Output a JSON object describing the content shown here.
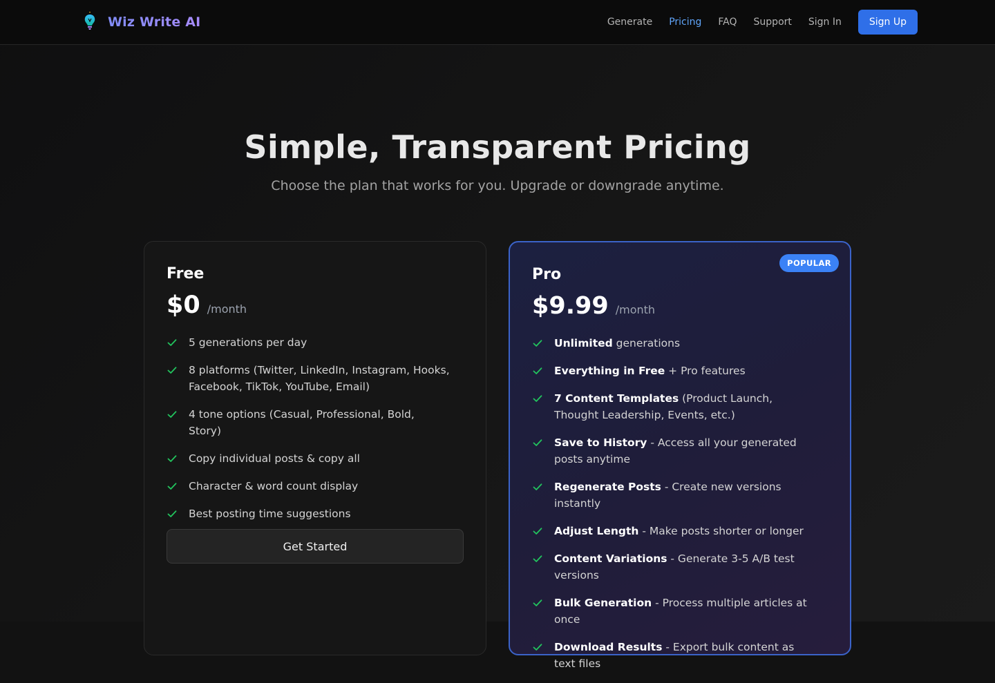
{
  "brand": {
    "name": "Wiz Write AI",
    "icon": "wizard-bulb-icon"
  },
  "nav": {
    "items": [
      {
        "label": "Generate",
        "active": false
      },
      {
        "label": "Pricing",
        "active": true
      },
      {
        "label": "FAQ",
        "active": false
      },
      {
        "label": "Support",
        "active": false
      },
      {
        "label": "Sign In",
        "active": false
      }
    ],
    "signup_label": "Sign Up"
  },
  "hero": {
    "title": "Simple, Transparent Pricing",
    "subtitle": "Choose the plan that works for you. Upgrade or downgrade anytime."
  },
  "plans": [
    {
      "name": "Free",
      "price": "$0",
      "period": "/month",
      "features": [
        {
          "bold": "",
          "text": "5 generations per day"
        },
        {
          "bold": "",
          "text": "8 platforms (Twitter, LinkedIn, Instagram, Hooks, Facebook, TikTok, YouTube, Email)"
        },
        {
          "bold": "",
          "text": "4 tone options (Casual, Professional, Bold, Story)"
        },
        {
          "bold": "",
          "text": "Copy individual posts & copy all"
        },
        {
          "bold": "",
          "text": "Character & word count display"
        },
        {
          "bold": "",
          "text": "Best posting time suggestions"
        }
      ],
      "cta_label": "Get Started"
    },
    {
      "name": "Pro",
      "badge": "POPULAR",
      "price": "$9.99",
      "period": "/month",
      "features": [
        {
          "bold": "Unlimited",
          "text": " generations"
        },
        {
          "bold": "Everything in Free",
          "text": " + Pro features"
        },
        {
          "bold": "7 Content Templates",
          "text": " (Product Launch, Thought Leadership, Events, etc.)"
        },
        {
          "bold": "Save to History",
          "text": " - Access all your generated posts anytime"
        },
        {
          "bold": "Regenerate Posts",
          "text": " - Create new versions instantly"
        },
        {
          "bold": "Adjust Length",
          "text": " - Make posts shorter or longer"
        },
        {
          "bold": "Content Variations",
          "text": " - Generate 3-5 A/B test versions"
        },
        {
          "bold": "Bulk Generation",
          "text": " - Process multiple articles at once"
        },
        {
          "bold": "Download Results",
          "text": " - Export bulk content as text files"
        }
      ]
    }
  ],
  "colors": {
    "accent": "#2f6fe8",
    "active_nav": "#60a5fa",
    "check": "#22c55e",
    "badge": "#3b82f6",
    "pro_border": "#3b63c9"
  }
}
